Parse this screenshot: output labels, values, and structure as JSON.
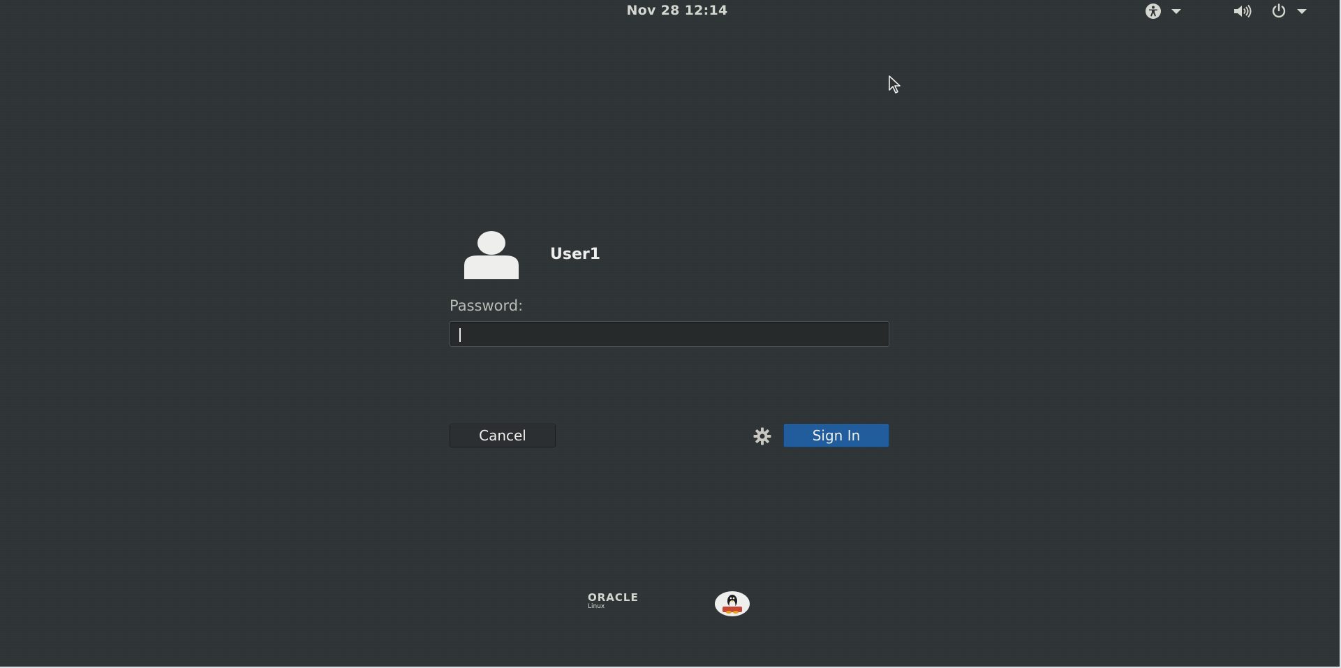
{
  "top_bar": {
    "clock": "Nov 28  12:14",
    "icons": [
      "accessibility-icon",
      "volume-icon",
      "power-icon"
    ]
  },
  "login": {
    "user_name": "User1",
    "password_label": "Password:",
    "password_value": "",
    "cancel_label": "Cancel",
    "signin_label": "Sign In",
    "session_icon": "gear-icon"
  },
  "branding": {
    "oracle_word": "ORACLE",
    "oracle_sub": "Linux"
  },
  "colors": {
    "background": "#2e3436",
    "accent": "#215d9c"
  }
}
